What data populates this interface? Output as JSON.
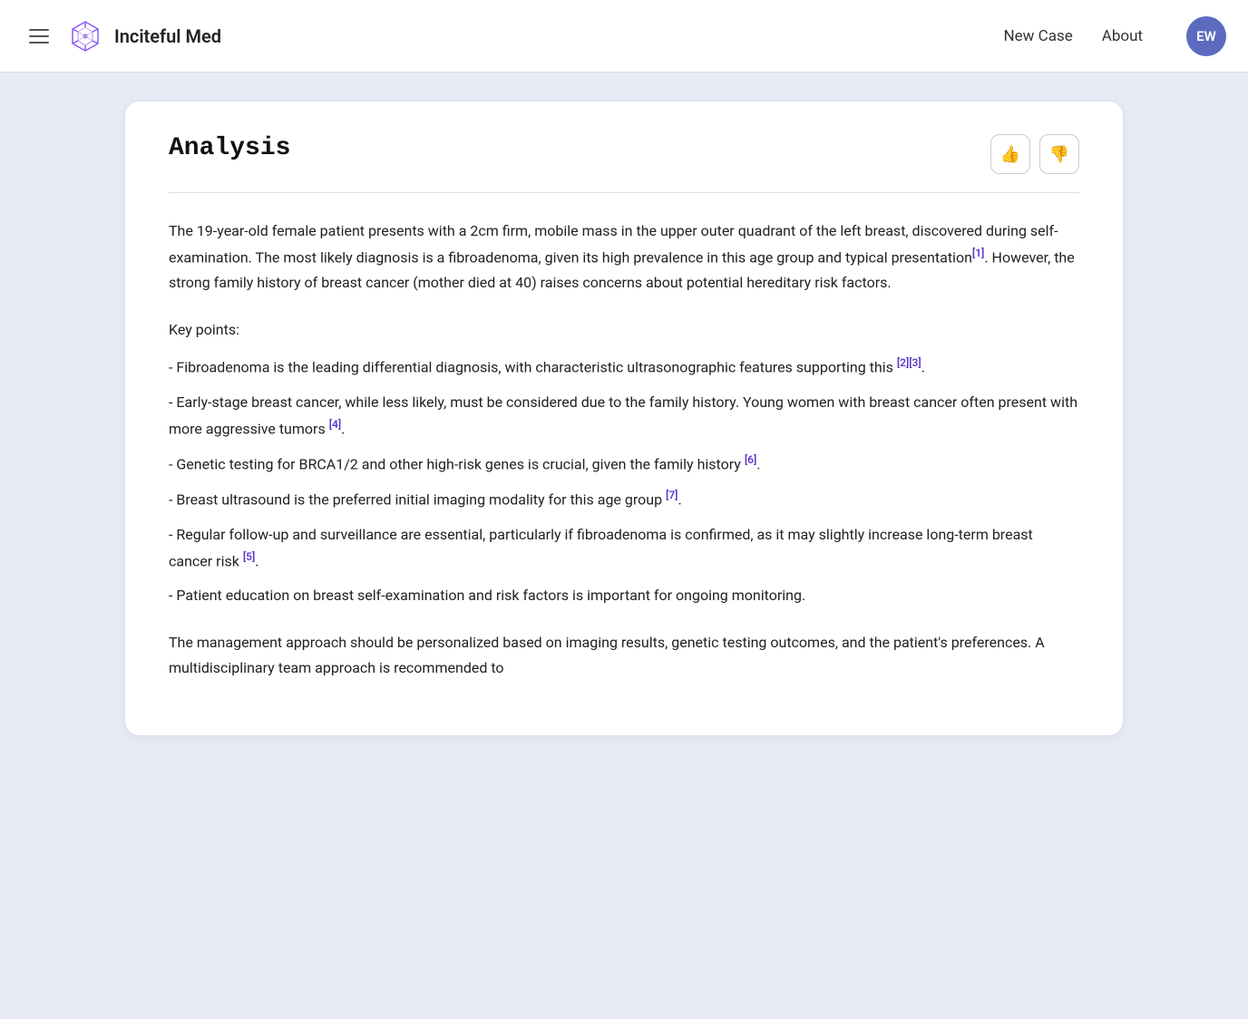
{
  "header": {
    "menu_icon": "hamburger-icon",
    "brand_name": "Inciteful Med",
    "nav": {
      "new_case": "New Case",
      "about": "About"
    },
    "avatar_initials": "EW"
  },
  "card": {
    "title": "Analysis",
    "thumbs_up_label": "👍",
    "thumbs_down_label": "👎",
    "paragraph1": "The 19-year-old female patient presents with a 2cm firm, mobile mass in the upper outer quadrant of the left breast, discovered during self-examination. The most likely diagnosis is a fibroadenoma, given its high prevalence in this age group and typical presentation",
    "cite1": "[1]",
    "paragraph1_cont": ". However, the strong family history of breast cancer (mother died at 40) raises concerns about potential hereditary risk factors.",
    "key_points_title": "Key points:",
    "points": [
      {
        "text": "- Fibroadenoma is the leading differential diagnosis, with characteristic ultrasonographic features supporting this",
        "cite": "[2][3]",
        "suffix": "."
      },
      {
        "text": "- Early-stage breast cancer, while less likely, must be considered due to the family history. Young women with breast cancer often present with more aggressive tumors",
        "cite": "[4]",
        "suffix": "."
      },
      {
        "text": "- Genetic testing for BRCA1/2 and other high-risk genes is crucial, given the family history",
        "cite": "[6]",
        "suffix": "."
      },
      {
        "text": "- Breast ultrasound is the preferred initial imaging modality for this age group",
        "cite": "[7]",
        "suffix": "."
      },
      {
        "text": "- Regular follow-up and surveillance are essential, particularly if fibroadenoma is confirmed, as it may slightly increase long-term breast cancer risk",
        "cite": "[5]",
        "suffix": "."
      },
      {
        "text": "- Patient education on breast self-examination and risk factors is important for ongoing monitoring.",
        "cite": "",
        "suffix": ""
      }
    ],
    "paragraph3": "The management approach should be personalized based on imaging results, genetic testing outcomes, and the patient's preferences. A multidisciplinary team approach is recommended to"
  }
}
